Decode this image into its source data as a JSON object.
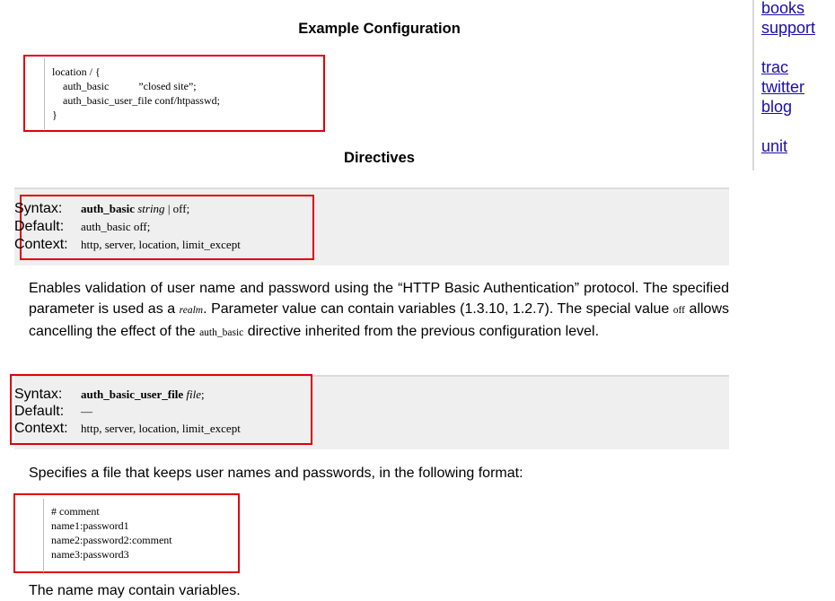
{
  "sidebar": {
    "links": [
      "books",
      "support",
      "trac",
      "twitter",
      "blog",
      "unit"
    ]
  },
  "example": {
    "heading": "Example Configuration",
    "code": [
      "location / {",
      "    auth_basic           ”closed site”;",
      "    auth_basic_user_file conf/htpasswd;",
      "}"
    ]
  },
  "directives": {
    "heading": "Directives",
    "auth_basic": {
      "syntax_label": "Syntax:",
      "syntax_name": "auth_basic",
      "syntax_arg": "string",
      "syntax_rest": " | off;",
      "default_label": "Default:",
      "default_value": "auth_basic off;",
      "context_label": "Context:",
      "context_value": "http, server, location, limit_except"
    },
    "auth_basic_desc": {
      "p1": "Enables validation of user name and password using the “HTTP Basic Authentication” protocol. The specified parameter is used as a ",
      "realm": "realm",
      "p2": ". Parameter value can contain variables (1.3.10, 1.2.7). The special value ",
      "off": "off",
      "p3": " allows cancelling the effect of the ",
      "directive": "auth_basic",
      "p4": " directive inherited from the previous configuration level."
    },
    "auth_basic_user_file": {
      "syntax_label": "Syntax:",
      "syntax_name": "auth_basic_user_file",
      "syntax_arg": "file",
      "syntax_rest": ";",
      "default_label": "Default:",
      "default_value": "—",
      "context_label": "Context:",
      "context_value": "http, server, location, limit_except"
    },
    "user_file_desc": "Specifies a file that keeps user names and passwords, in the following format:",
    "format_code": [
      "# comment",
      "name1:password1",
      "name2:password2:comment",
      "name3:password3"
    ],
    "trailing_text": "The name may contain variables."
  },
  "colors": {
    "highlight_border": "#e0000a",
    "directive_background": "#efefef",
    "link": "#1a0dab"
  }
}
